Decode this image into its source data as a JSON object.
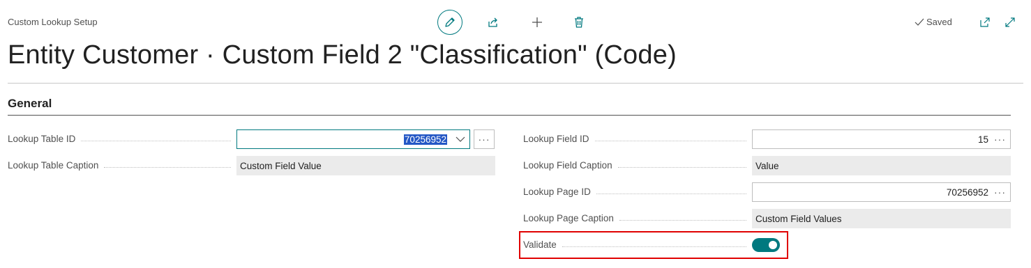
{
  "header": {
    "page_caption": "Custom Lookup Setup",
    "saved_label": "Saved",
    "title": "Entity Customer · Custom Field 2 \"Classification\" (Code)"
  },
  "actions": {
    "edit": "edit-icon",
    "share": "share-icon",
    "new": "plus-icon",
    "delete": "delete-icon",
    "open_new_window": "open-new-window-icon",
    "expand": "expand-icon"
  },
  "section": {
    "title": "General"
  },
  "fields": {
    "lookup_table_id": {
      "label": "Lookup Table ID",
      "value": "70256952"
    },
    "lookup_table_caption": {
      "label": "Lookup Table Caption",
      "value": "Custom Field Value"
    },
    "lookup_field_id": {
      "label": "Lookup Field ID",
      "value": "15"
    },
    "lookup_field_caption": {
      "label": "Lookup Field Caption",
      "value": "Value"
    },
    "lookup_page_id": {
      "label": "Lookup Page ID",
      "value": "70256952"
    },
    "lookup_page_caption": {
      "label": "Lookup Page Caption",
      "value": "Custom Field Values"
    },
    "validate": {
      "label": "Validate",
      "value": true
    }
  },
  "ellipsis": "···",
  "colors": {
    "accent": "#00797f",
    "highlight_border": "#e00000",
    "selection": "#2457c5"
  }
}
